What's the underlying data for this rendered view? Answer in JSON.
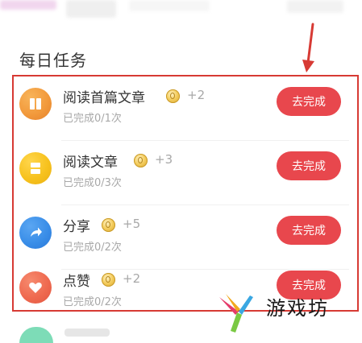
{
  "section_title": "每日任务",
  "tasks": [
    {
      "name": "阅读首篇文章",
      "reward": "+2",
      "progress": "已完成0/1次",
      "button": "去完成",
      "icon": "book-icon",
      "icon_color": "#f29a3c"
    },
    {
      "name": "阅读文章",
      "reward": "+3",
      "progress": "已完成0/3次",
      "button": "去完成",
      "icon": "article-icon",
      "icon_color": "#f7c21e"
    },
    {
      "name": "分享",
      "reward": "+5",
      "progress": "已完成0/2次",
      "button": "去完成",
      "icon": "share-icon",
      "icon_color": "#3a8ee8"
    },
    {
      "name": "点赞",
      "reward": "+2",
      "progress": "已完成0/2次",
      "button": "去完成",
      "icon": "heart-icon",
      "icon_color": "#ef6a50"
    }
  ],
  "colors": {
    "button": "#e8474d",
    "annotation": "#d73a34"
  },
  "watermark": {
    "text": "游戏坊"
  }
}
